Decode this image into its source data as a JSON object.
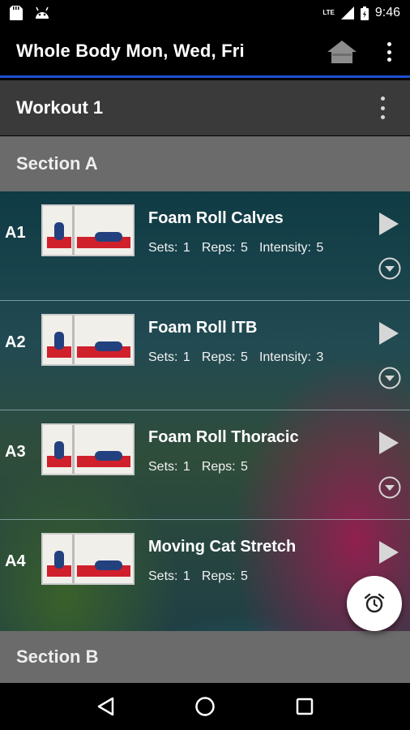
{
  "status_bar": {
    "time": "9:46",
    "network": "LTE",
    "icons": [
      "sd-card-icon",
      "android-icon",
      "signal-icon",
      "battery-icon"
    ]
  },
  "app_bar": {
    "title": "Whole Body Mon, Wed, Fri",
    "home_icon": "home-icon",
    "overflow_icon": "more-vert-icon",
    "accent_color": "#1d4fd0"
  },
  "workout": {
    "title": "Workout 1",
    "menu_icon": "more-vert-icon"
  },
  "sections": [
    {
      "title": "Section A",
      "exercises": [
        {
          "code": "A1",
          "name": "Foam Roll Calves",
          "sets": "Sets: 1",
          "reps": "Reps: 5",
          "intensity": "Intensity: 5",
          "has_expand": true
        },
        {
          "code": "A2",
          "name": "Foam Roll ITB",
          "sets": "Sets: 1",
          "reps": "Reps: 5",
          "intensity": "Intensity: 3",
          "has_expand": true
        },
        {
          "code": "A3",
          "name": "Foam Roll Thoracic",
          "sets": "Sets: 1",
          "reps": "Reps: 5",
          "intensity": "",
          "has_expand": true
        },
        {
          "code": "A4",
          "name": "Moving Cat Stretch",
          "sets": "Sets: 1",
          "reps": "Reps: 5",
          "intensity": "",
          "has_expand": false
        }
      ]
    },
    {
      "title": "Section B"
    }
  ],
  "fab": {
    "icon": "alarm-clock-icon"
  },
  "nav_bar": {
    "icons": [
      "back-icon",
      "home-circle-icon",
      "recents-icon"
    ]
  }
}
